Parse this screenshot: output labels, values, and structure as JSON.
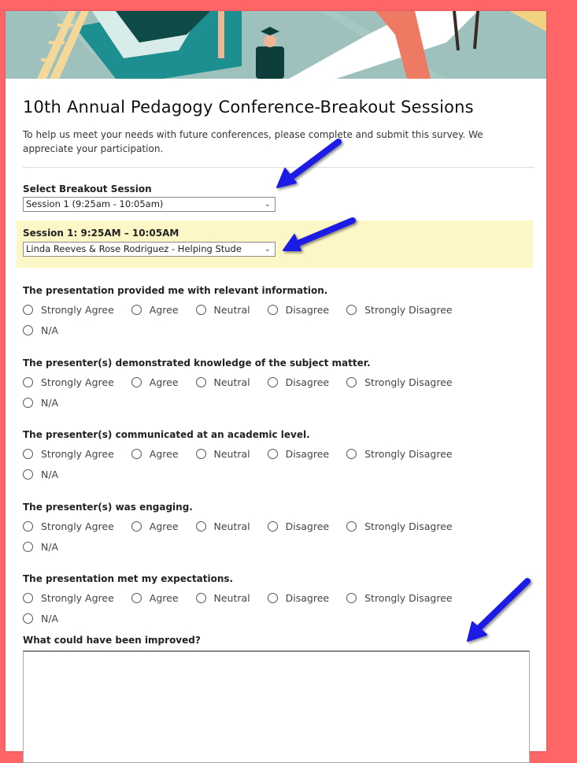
{
  "form": {
    "title": "10th Annual Pedagogy Conference-Breakout Sessions",
    "intro": "To help us meet your needs with future conferences, please complete and submit this survey. We appreciate your participation.",
    "session_select": {
      "label": "Select Breakout Session",
      "value": "Session 1 (9:25am - 10:05am)"
    },
    "presentation_select": {
      "label": "Session 1: 9:25AM – 10:05AM",
      "value": "Linda Reeves & Rose Rodriguez - Helping Stude"
    },
    "rating_options": [
      "Strongly Agree",
      "Agree",
      "Neutral",
      "Disagree",
      "Strongly Disagree",
      "N/A"
    ],
    "questions": [
      {
        "label": "The presentation provided me with relevant information."
      },
      {
        "label": "The presenter(s) demonstrated knowledge of the subject matter."
      },
      {
        "label": "The presenter(s) communicated at an academic level."
      },
      {
        "label": "The presenter(s) was engaging."
      },
      {
        "label": "The presentation met my expectations."
      }
    ],
    "improve": {
      "label": "What could have been improved?",
      "value": ""
    }
  },
  "colors": {
    "background": "#fd6566",
    "highlight": "#fdf6c6",
    "arrow": "#1a1ae6"
  }
}
